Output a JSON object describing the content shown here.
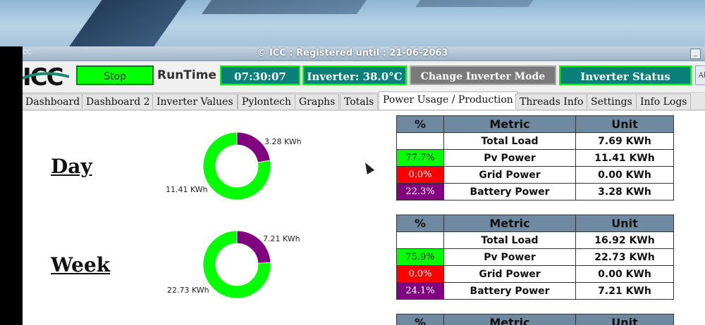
{
  "window": {
    "title": "© ICC : Registered until : 21-06-2063",
    "corner_label": "CC",
    "minimize": "_"
  },
  "toolbar": {
    "logo": "ICC",
    "stop_label": "Stop",
    "runtime_label": "RunTime",
    "runtime_value": "07:30:07",
    "inverter_temp": "Inverter: 38.0°C",
    "change_mode_label": "Change Inverter Mode",
    "inverter_status_label": "Inverter Status",
    "edge_button": "Al"
  },
  "tabs": [
    "Dashboard",
    "Dashboard 2",
    "Inverter Values",
    "Pylontech",
    "Graphs",
    "Totals",
    "Power Usage / Production",
    "Threads Info",
    "Settings",
    "Info Logs"
  ],
  "active_tab": "Power Usage / Production",
  "table_headers": {
    "pct": "%",
    "metric": "Metric",
    "unit": "Unit"
  },
  "colors": {
    "pv": "#00ff00",
    "grid": "#ff0000",
    "battery": "#800080",
    "header": "#6f8aa0",
    "teal": "#0b8079"
  },
  "periods": [
    {
      "name": "Day",
      "pie": {
        "pv_label": "11.41 KWh",
        "battery_label": "3.28 KWh",
        "pv_value": 11.41,
        "battery_value": 3.28
      },
      "rows": [
        {
          "pct": "",
          "metric": "Total Load",
          "unit": "7.69 KWh",
          "color": ""
        },
        {
          "pct": "77.7%",
          "metric": "Pv Power",
          "unit": "11.41 KWh",
          "color": "#00ff00"
        },
        {
          "pct": "0.0%",
          "metric": "Grid Power",
          "unit": "0.00 KWh",
          "color": "#ff0000"
        },
        {
          "pct": "22.3%",
          "metric": "Battery Power",
          "unit": "3.28 KWh",
          "color": "#800080"
        }
      ]
    },
    {
      "name": "Week",
      "pie": {
        "pv_label": "22.73 KWh",
        "battery_label": "7.21 KWh",
        "pv_value": 22.73,
        "battery_value": 7.21
      },
      "rows": [
        {
          "pct": "",
          "metric": "Total Load",
          "unit": "16.92 KWh",
          "color": ""
        },
        {
          "pct": "75.9%",
          "metric": "Pv Power",
          "unit": "22.73 KWh",
          "color": "#00ff00"
        },
        {
          "pct": "0.0%",
          "metric": "Grid Power",
          "unit": "0.00 KWh",
          "color": "#ff0000"
        },
        {
          "pct": "24.1%",
          "metric": "Battery Power",
          "unit": "7.21 KWh",
          "color": "#800080"
        }
      ]
    }
  ],
  "third_table_headers": {
    "pct": "%",
    "metric": "Metric",
    "unit": "Unit"
  }
}
